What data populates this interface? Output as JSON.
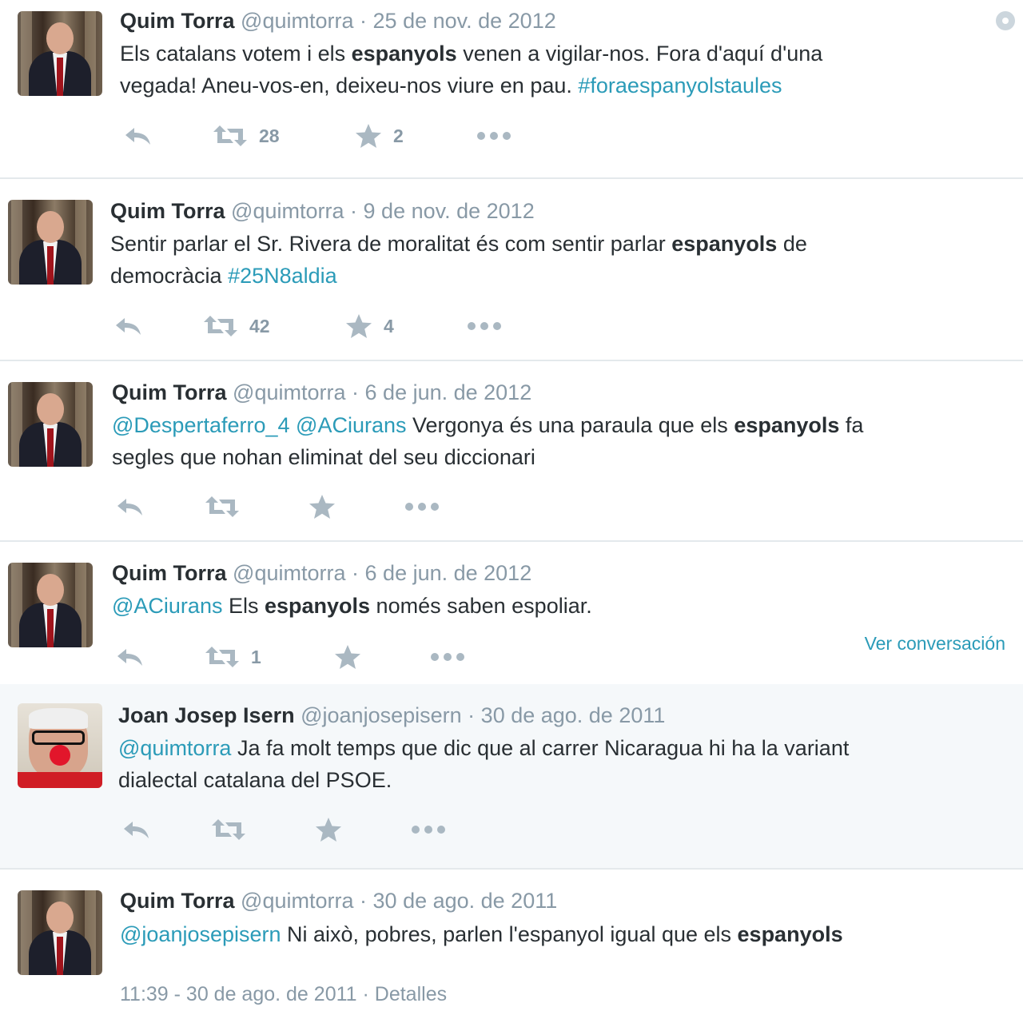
{
  "tweets": [
    {
      "name": "Quim Torra",
      "handle": "@quimtorra",
      "date": "25 de nov. de 2012",
      "line1": [
        {
          "t": "Els catalans votem i els ",
          "s": "n"
        },
        {
          "t": "espanyols",
          "s": "b"
        },
        {
          "t": " venen a vigilar-nos. Fora d'aquí d'una",
          "s": "n"
        }
      ],
      "line2": [
        {
          "t": "vegada! Aneu-vos-en, deixeu-nos viure en pau. ",
          "s": "n"
        },
        {
          "t": "#foraespanyolstaules",
          "s": "l"
        }
      ],
      "retweets": "28",
      "favorites": "2"
    },
    {
      "name": "Quim Torra",
      "handle": "@quimtorra",
      "date": "9 de nov. de 2012",
      "line1": [
        {
          "t": "Sentir parlar el Sr. Rivera de moralitat és com sentir parlar ",
          "s": "n"
        },
        {
          "t": "espanyols",
          "s": "b"
        },
        {
          "t": " de",
          "s": "n"
        }
      ],
      "line2": [
        {
          "t": "democràcia ",
          "s": "n"
        },
        {
          "t": "#25N8aldia",
          "s": "l"
        }
      ],
      "retweets": "42",
      "favorites": "4"
    },
    {
      "name": "Quim Torra",
      "handle": "@quimtorra",
      "date": "6 de jun. de 2012",
      "line1": [
        {
          "t": "@Despertaferro_4",
          "s": "l"
        },
        {
          "t": " ",
          "s": "n"
        },
        {
          "t": "@ACiurans",
          "s": "l"
        },
        {
          "t": " Vergonya és una paraula que els ",
          "s": "n"
        },
        {
          "t": "espanyols",
          "s": "b"
        },
        {
          "t": " fa",
          "s": "n"
        }
      ],
      "line2": [
        {
          "t": "segles que nohan eliminat del seu diccionari",
          "s": "n"
        }
      ],
      "retweets": "",
      "favorites": ""
    },
    {
      "name": "Quim Torra",
      "handle": "@quimtorra",
      "date": "6 de jun. de 2012",
      "line1": [
        {
          "t": "@ACiurans",
          "s": "l"
        },
        {
          "t": " Els ",
          "s": "n"
        },
        {
          "t": "espanyols",
          "s": "b"
        },
        {
          "t": " només saben espoliar.",
          "s": "n"
        }
      ],
      "line2": [],
      "retweets": "1",
      "favorites": "",
      "conversation": "Ver conversación"
    },
    {
      "name": "Joan Josep Isern",
      "handle": "@joanjosepisern",
      "date": "30 de ago. de 2011",
      "line1": [
        {
          "t": "@quimtorra",
          "s": "l"
        },
        {
          "t": " Ja fa molt temps que dic que al carrer Nicaragua hi ha la variant",
          "s": "n"
        }
      ],
      "line2": [
        {
          "t": "dialectal catalana del PSOE.",
          "s": "n"
        }
      ],
      "retweets": "",
      "favorites": ""
    },
    {
      "name": "Quim Torra",
      "handle": "@quimtorra",
      "date": "30 de ago. de 2011",
      "line1": [
        {
          "t": "@joanjosepisern",
          "s": "l"
        },
        {
          "t": " Ni això, pobres, parlen l'espanyol igual que els ",
          "s": "n"
        },
        {
          "t": "espanyols",
          "s": "b"
        }
      ],
      "line2": [],
      "footer_time": "11:39 - 30 de ago. de 2011",
      "footer_details": "Detalles"
    }
  ],
  "dot": "·",
  "icons": [
    "reply-icon",
    "retweet-icon",
    "favorite-star-icon",
    "more-options-icon",
    "gear-icon"
  ],
  "colors": {
    "link": "#2b9bb8",
    "muted": "#8899a6",
    "icon": "#aab8c2",
    "highlight_bg": "#f5f8fa"
  }
}
